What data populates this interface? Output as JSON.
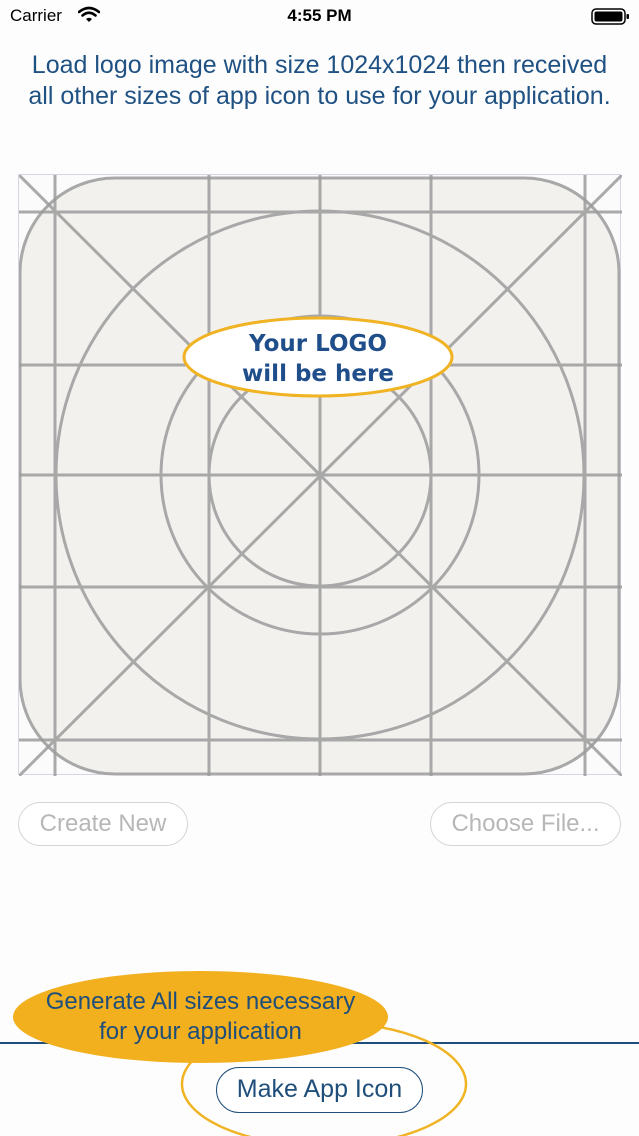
{
  "status_bar": {
    "carrier": "Carrier",
    "time": "4:55 PM"
  },
  "instructions": "Load logo image with size 1024x1024 then received all other sizes of app icon to use for your application.",
  "template": {
    "logo_line1": "Your LOGO",
    "logo_line2": "will be here"
  },
  "buttons": {
    "create_new": "Create New",
    "choose_file": "Choose File...",
    "make_app_icon": "Make App Icon"
  },
  "hint": "Generate All sizes necessary for your application",
  "colors": {
    "accent_blue": "#1f4e7a",
    "highlight_yellow": "#f2b01f",
    "disabled_gray": "#b7b7b7"
  }
}
